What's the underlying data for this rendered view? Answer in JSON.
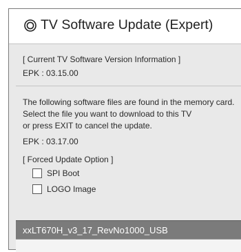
{
  "dialog": {
    "title": "TV Software Update (Expert)",
    "title_icon": "circled-ring-icon"
  },
  "current": {
    "header": "[ Current TV Software Version Information ]",
    "version": "EPK : 03.15.00"
  },
  "found": {
    "line1": "The following software files are found in the memory card.",
    "line2": "Select the file you want to download to this TV",
    "line3": "or press EXIT to cancel the update.",
    "version": "EPK : 03.17.00"
  },
  "forced": {
    "header": "[ Forced Update Option ]",
    "options": [
      {
        "label": "SPI Boot",
        "checked": false
      },
      {
        "label": "LOGO Image",
        "checked": false
      }
    ]
  },
  "files": [
    {
      "name": "xxLT670H_v3_17_RevNo1000_USB",
      "selected": true
    },
    {
      "name": "",
      "selected": false
    }
  ],
  "colors": {
    "selected_bg": "#7b7b7b",
    "panel_bg": "#e9e9e9"
  }
}
